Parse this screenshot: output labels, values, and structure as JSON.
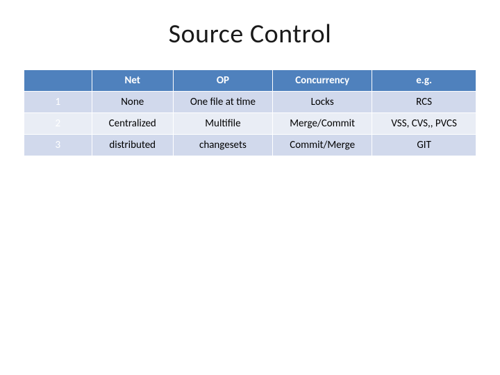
{
  "title": "Source Control",
  "table": {
    "headers": [
      "",
      "Net",
      "OP",
      "Concurrency",
      "e.g."
    ],
    "rows": [
      {
        "label": "1",
        "cells": [
          "None",
          "One file at time",
          "Locks",
          "RCS"
        ]
      },
      {
        "label": "2",
        "cells": [
          "Centralized",
          "Multifile",
          "Merge/Commit",
          "VSS, CVS,, PVCS"
        ]
      },
      {
        "label": "3",
        "cells": [
          "distributed",
          "changesets",
          "Commit/Merge",
          "GIT"
        ]
      }
    ]
  }
}
